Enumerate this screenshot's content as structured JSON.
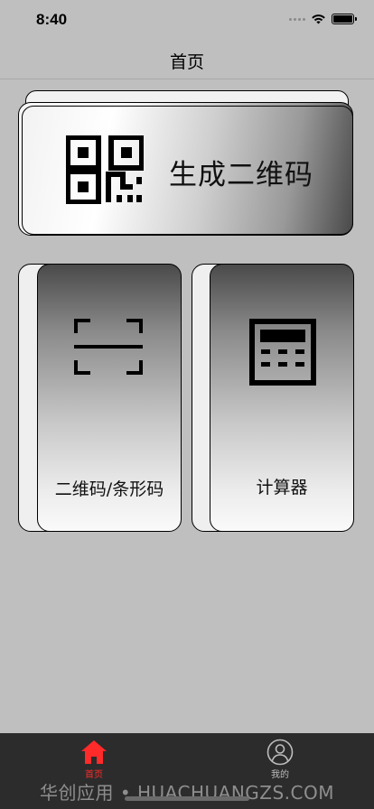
{
  "status_bar": {
    "time": "8:40",
    "icons": [
      "signal-icon",
      "wifi-icon",
      "battery-icon"
    ]
  },
  "nav": {
    "title": "首页"
  },
  "cards": {
    "qr_generate": {
      "label": "生成二维码",
      "icon": "qr-code-icon"
    },
    "scan": {
      "label": "二维码/条形码",
      "icon": "scan-icon"
    },
    "calculator": {
      "label": "计算器",
      "icon": "calculator-icon"
    }
  },
  "tab_bar": {
    "active_color": "#ff2a2a",
    "items": [
      {
        "label": "首页",
        "icon": "home-icon",
        "active": true
      },
      {
        "label": "我的",
        "icon": "user-icon",
        "active": false
      }
    ]
  },
  "watermark": "华创应用 • HUACHUANGZS.COM"
}
